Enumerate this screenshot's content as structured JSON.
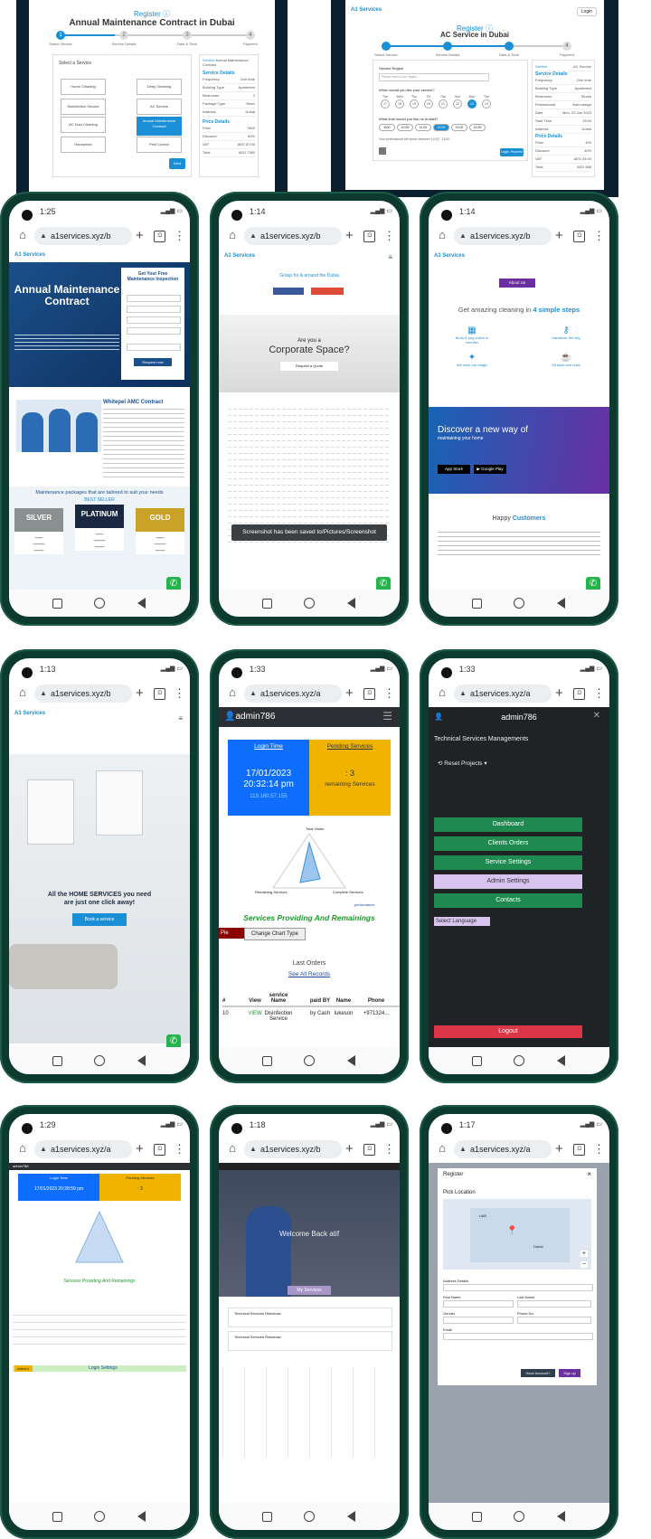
{
  "top_left": {
    "register": "Register",
    "title": "Annual Maintenance Contract in Dubai",
    "steps": [
      "Select Service",
      "Service Details",
      "Date & Time",
      "Payment"
    ],
    "select_service_label": "Select a Service",
    "services": [
      "Home Cleaning",
      "Deep Cleaning",
      "Disinfection Service",
      "AC Service",
      "AC Duct Cleaning",
      "Annual Maintenance Contract",
      "Handyman",
      "Pest Control"
    ],
    "next_button": "Next",
    "summary_header": "Service",
    "summary_header_value": "Annual Maintenance Contract",
    "service_details_title": "Service Details",
    "details": [
      [
        "Frequency",
        "One time"
      ],
      [
        "Building Type",
        "Apartment"
      ],
      [
        "Bedrooms",
        "2"
      ],
      [
        "Package Type",
        "Silver"
      ],
      [
        "Address",
        "Dubai"
      ]
    ],
    "price_title": "Price Details",
    "prices": [
      [
        "Price",
        "7800"
      ],
      [
        "Discount",
        "60%"
      ],
      [
        "VAT",
        "AED 87.00"
      ],
      [
        "Total",
        "AED 7380"
      ]
    ]
  },
  "top_right": {
    "login": "Login",
    "register": "Register",
    "title": "AC Service in Dubai",
    "steps": [
      "Select Service",
      "Service Details",
      "Date & Time",
      "Payment"
    ],
    "service_region": "Service Region",
    "region_placeholder": "Please select your region",
    "when_q": "When would you like your service?",
    "days": [
      "Tue",
      "Wed",
      "Thu",
      "Fri",
      "Sat",
      "Sun",
      "Mon",
      "Tue"
    ],
    "dates": [
      "17",
      "18",
      "19",
      "20",
      "21",
      "22",
      "23",
      "24"
    ],
    "time_q": "What time would you like us to start?",
    "times": [
      "8:00",
      "10:00",
      "11:00",
      "12:00",
      "13:00",
      "14:00"
    ],
    "prof_note": "Your professional will arrive between 12:00 - 13:00",
    "next": "Login, Proceed",
    "summary_service": "Service",
    "summary_service_value": "AC Service",
    "service_details_title": "Service Details",
    "details": [
      [
        "Frequency",
        "One time"
      ],
      [
        "Building Type",
        "Apartment"
      ],
      [
        "Bedrooms",
        "Studio"
      ],
      [
        "Professional",
        "Auto assign"
      ],
      [
        "Date",
        "Mon, 23 Jan 2023"
      ],
      [
        "Start Time",
        "13:00"
      ],
      [
        "Address",
        "Dubai"
      ]
    ],
    "date_time_title": "Date & Time",
    "price_title": "Price Details",
    "prices": [
      [
        "Price",
        "400"
      ],
      [
        "Discount",
        "40%"
      ],
      [
        "VAT",
        "AED 28.00"
      ],
      [
        "Total",
        "AED 588"
      ]
    ]
  },
  "phones": [
    {
      "time": "1:25",
      "url": "a1services.xyz/b",
      "key": "p1"
    },
    {
      "time": "1:14",
      "url": "a1services.xyz/b",
      "key": "p2"
    },
    {
      "time": "1:14",
      "url": "a1services.xyz/b",
      "key": "p3"
    },
    {
      "time": "1:13",
      "url": "a1services.xyz/b",
      "key": "p4"
    },
    {
      "time": "1:33",
      "url": "a1services.xyz/a",
      "key": "p5"
    },
    {
      "time": "1:33",
      "url": "a1services.xyz/a",
      "key": "p6"
    },
    {
      "time": "1:29",
      "url": "a1services.xyz/a",
      "key": "p7"
    },
    {
      "time": "1:18",
      "url": "a1services.xyz/b",
      "key": "p8"
    },
    {
      "time": "1:17",
      "url": "a1services.xyz/a",
      "key": "p9"
    }
  ],
  "p1": {
    "logo": "A1 Services",
    "hero": "Annual Maintenance Contract",
    "form_title": "Get Your Free Maintenance Inspection",
    "submit": "Request now",
    "amc_title": "Whitepel AMC Contract",
    "packages_heading": "Maintenance packages that are tailored to suit your needs",
    "best_seller": "BEST SELLER",
    "packages": [
      "SILVER",
      "PLATINUM",
      "GOLD"
    ]
  },
  "p2": {
    "tagline": "Group for & around the Dubai",
    "corporate_q": "Are you a",
    "corporate": "Corporate Space?",
    "corporate_btn": "Request a Quote",
    "toast": "Screenshot has been saved to/Pictures/Screenshot"
  },
  "p3": {
    "about_btn": "About Us",
    "steps_heading_a": "Get amazing cleaning in ",
    "steps_heading_b": "4 simple steps",
    "steps": [
      "Book & pay online in minutes",
      "Handover the key",
      "We work our magic",
      "Sit back and relax"
    ],
    "discover": "Discover a new way of",
    "discover_sub": "maintaining your home",
    "app_store": "App Store",
    "google_play": "Google Play",
    "happy": "Happy ",
    "customers": "Customers"
  },
  "p4": {
    "headline_1": "All the HOME SERVICES you need",
    "headline_2": "are just one click away!",
    "btn": "Book a service"
  },
  "p5": {
    "user": "admin786",
    "login_time_label": "Login Time",
    "date": "17/01/2023",
    "time": "20:32:14 pm",
    "ip": "119.160.57.155",
    "pending_label": "Pending Services",
    "pending_count": ": 3",
    "remaining": "remaining Services",
    "radar_top": "Total Visitor",
    "radar_left": "Remaining Services",
    "radar_right": "Complete Services",
    "performance": "performance",
    "heading": "Services Providing And Remainings",
    "pie": "Pie",
    "change_chart": "Change Chart Type",
    "last_orders": "Last Orders",
    "see_all": "See All Records",
    "cols": [
      "#",
      "View",
      "service Name",
      "paid BY",
      "Name",
      "Phone"
    ],
    "row": [
      "10",
      "VIEW",
      "Disinfection Service",
      "by Cash",
      "lukeson",
      "+971324..."
    ]
  },
  "p6": {
    "user": "admin786",
    "section": "Technical Services Managements",
    "reset": "Reset Projects",
    "items": [
      "Dashboard",
      "Clients Orders",
      "Service Settings",
      "Admin Settings",
      "Contacts"
    ],
    "lang": "Select Language",
    "logout": "Logout"
  },
  "p7": {
    "user": "admin786",
    "login_time_label": "Login Time",
    "date": "17/01/2023 20:28:59 pm",
    "pending_label": "Pending Services",
    "pending_count": ": 3",
    "heading": "Services Providing And Remainings",
    "settings": "Login Settings",
    "tag": "Admin1"
  },
  "p8": {
    "welcome": "Welcome Back atif",
    "services": "My Services",
    "notif1": "Technical Services Rinkshaw",
    "notif2": "Technical Services Rinkshaw"
  },
  "p9": {
    "register": "Register",
    "pick": "Pick Location",
    "map_labels": [
      "UAE",
      "Dubai"
    ],
    "address": "Address Details",
    "first": "First Name",
    "last": "Last Name",
    "gender": "Gender",
    "phone": "Phone No",
    "email": "Email",
    "have_account": "Have Account?",
    "sign_up": "Sign up"
  }
}
